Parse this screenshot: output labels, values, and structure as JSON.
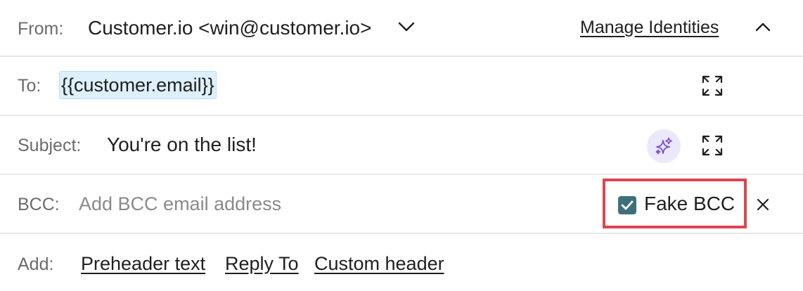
{
  "from": {
    "label": "From:",
    "value": "Customer.io <win@customer.io>",
    "manage_link": "Manage Identities"
  },
  "to": {
    "label": "To:",
    "token": "{{customer.email}}"
  },
  "subject": {
    "label": "Subject:",
    "value": "You're on the list!"
  },
  "bcc": {
    "label": "BCC:",
    "placeholder": "Add BCC email address",
    "fake_bcc_label": "Fake BCC",
    "fake_bcc_checked": true
  },
  "add": {
    "label": "Add:",
    "links": [
      "Preheader text",
      "Reply To",
      "Custom header"
    ]
  },
  "icons": {
    "from_dropdown": "chevron-down-icon",
    "collapse": "chevron-up-icon",
    "to_expand": "expand-icon",
    "subject_ai": "sparkles-icon",
    "subject_expand": "expand-icon",
    "bcc_remove": "close-icon",
    "checkbox": "check-icon"
  },
  "colors": {
    "highlight_border": "#e0444e",
    "checkbox": "#3f6f7b",
    "ai_accent": "#7b4ee0",
    "token_bg": "#ddf0fb"
  }
}
